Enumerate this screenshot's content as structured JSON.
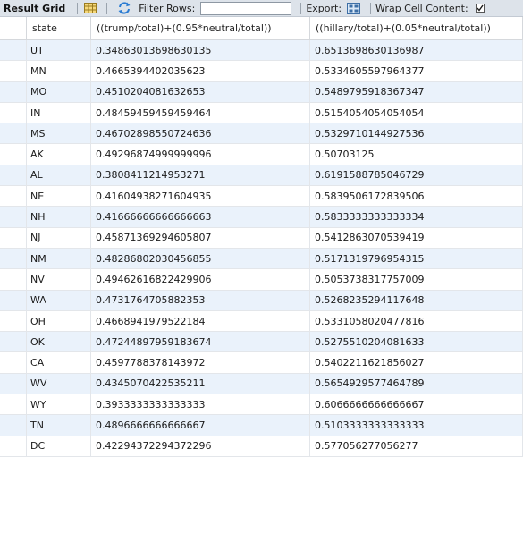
{
  "toolbar": {
    "result_grid_label": "Result Grid",
    "filter_label": "Filter Rows:",
    "filter_value": "",
    "export_label": "Export:",
    "wrap_label": "Wrap Cell Content:"
  },
  "grid": {
    "columns": [
      "state",
      "((trump/total)+(0.95*neutral/total))",
      "((hillary/total)+(0.05*neutral/total))"
    ],
    "rows": [
      {
        "state": "UT",
        "trump": "0.34863013698630135",
        "hillary": "0.6513698630136987"
      },
      {
        "state": "MN",
        "trump": "0.4665394402035623",
        "hillary": "0.5334605597964377"
      },
      {
        "state": "MO",
        "trump": "0.4510204081632653",
        "hillary": "0.5489795918367347"
      },
      {
        "state": "IN",
        "trump": "0.48459459459459464",
        "hillary": "0.5154054054054054"
      },
      {
        "state": "MS",
        "trump": "0.46702898550724636",
        "hillary": "0.5329710144927536"
      },
      {
        "state": "AK",
        "trump": "0.49296874999999996",
        "hillary": "0.50703125"
      },
      {
        "state": "AL",
        "trump": "0.3808411214953271",
        "hillary": "0.6191588785046729"
      },
      {
        "state": "NE",
        "trump": "0.41604938271604935",
        "hillary": "0.5839506172839506"
      },
      {
        "state": "NH",
        "trump": "0.41666666666666663",
        "hillary": "0.5833333333333334"
      },
      {
        "state": "NJ",
        "trump": "0.45871369294605807",
        "hillary": "0.5412863070539419"
      },
      {
        "state": "NM",
        "trump": "0.48286802030456855",
        "hillary": "0.5171319796954315"
      },
      {
        "state": "NV",
        "trump": "0.49462616822429906",
        "hillary": "0.5053738317757009"
      },
      {
        "state": "WA",
        "trump": "0.4731764705882353",
        "hillary": "0.5268235294117648"
      },
      {
        "state": "OH",
        "trump": "0.4668941979522184",
        "hillary": "0.5331058020477816"
      },
      {
        "state": "OK",
        "trump": "0.47244897959183674",
        "hillary": "0.5275510204081633"
      },
      {
        "state": "CA",
        "trump": "0.4597788378143972",
        "hillary": "0.5402211621856027"
      },
      {
        "state": "WV",
        "trump": "0.4345070422535211",
        "hillary": "0.5654929577464789"
      },
      {
        "state": "WY",
        "trump": "0.3933333333333333",
        "hillary": "0.6066666666666667"
      },
      {
        "state": "TN",
        "trump": "0.4896666666666667",
        "hillary": "0.5103333333333333"
      },
      {
        "state": "DC",
        "trump": "0.42294372294372296",
        "hillary": "0.577056277056277"
      }
    ]
  },
  "colors": {
    "toolbar_bg": "#dde3ea",
    "row_alt": "#eaf2fb",
    "grid_line": "#e3e6ea"
  },
  "icons": [
    "result-grid-icon",
    "refresh-icon",
    "export-icon",
    "wrap-check-icon"
  ]
}
